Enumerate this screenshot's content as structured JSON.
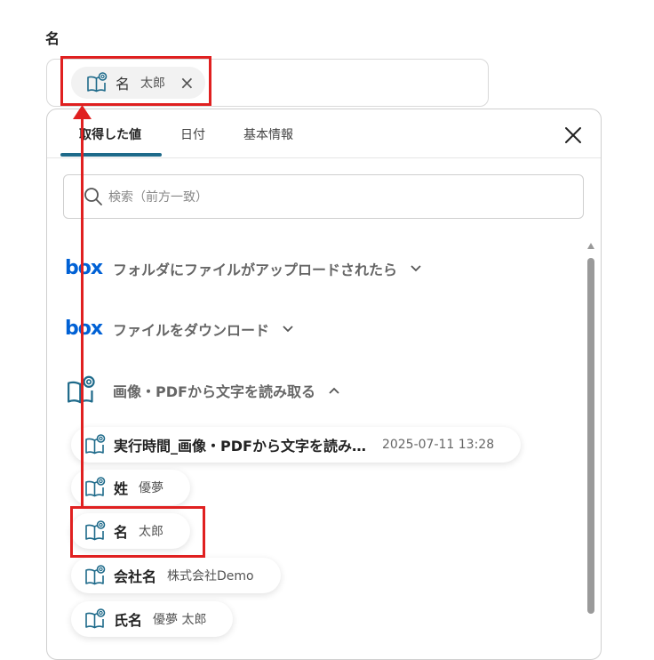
{
  "field": {
    "label": "名",
    "token": {
      "name": "名",
      "value": "太郎",
      "remove": "×"
    }
  },
  "panel": {
    "tabs": [
      {
        "label": "取得した値",
        "active": true
      },
      {
        "label": "日付",
        "active": false
      },
      {
        "label": "基本情報",
        "active": false
      }
    ],
    "search": {
      "placeholder": "検索（前方一致）",
      "value": ""
    },
    "sections": [
      {
        "logo": "box",
        "label": "フォルダにファイルがアップロードされたら",
        "expanded": false
      },
      {
        "logo": "box",
        "label": "ファイルをダウンロード",
        "expanded": false
      },
      {
        "logo": "ocr-book-icon",
        "label": "画像・PDFから文字を読み取る",
        "expanded": true
      }
    ],
    "items": [
      {
        "name": "実行時間_画像・PDFから文字を読み…",
        "value": "",
        "date": "2025-07-11 13:28"
      },
      {
        "name": "姓",
        "value": "優夢",
        "date": ""
      },
      {
        "name": "名",
        "value": "太郎",
        "date": ""
      },
      {
        "name": "会社名",
        "value": "株式会社Demo",
        "date": ""
      },
      {
        "name": "氏名",
        "value": "優夢 太郎",
        "date": ""
      }
    ]
  },
  "colors": {
    "accent": "#1e6a8a",
    "annotation": "#e02020",
    "box_brand": "#0061d5"
  }
}
